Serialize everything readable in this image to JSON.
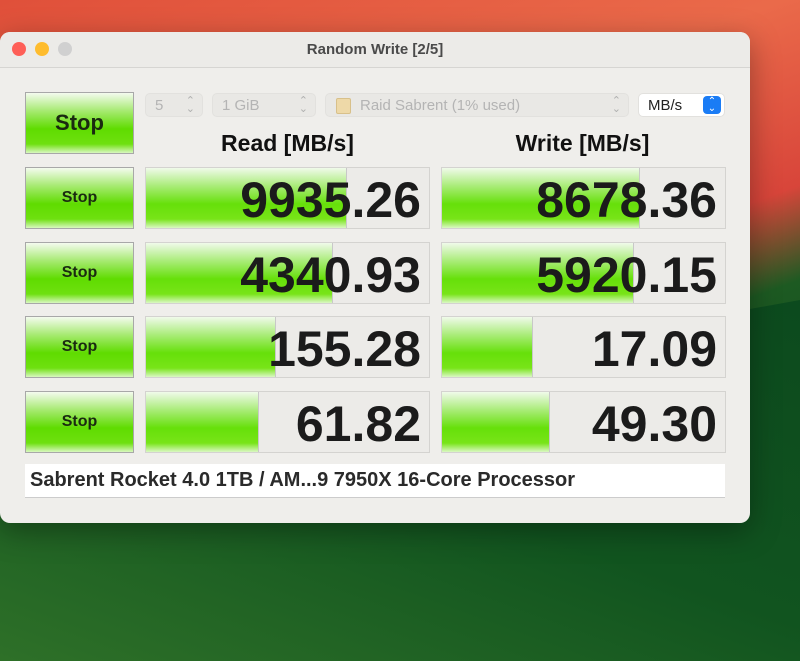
{
  "window": {
    "title": "Random Write [2/5]"
  },
  "controls": {
    "all_button": "Stop",
    "count": "5",
    "size": "1 GiB",
    "drive": "Raid Sabrent (1% used)",
    "unit": "MB/s"
  },
  "headers": {
    "read": "Read [MB/s]",
    "write": "Write [MB/s]"
  },
  "rows": [
    {
      "button": "Stop",
      "read": "9935.26",
      "read_fill": 0.71,
      "write": "8678.36",
      "write_fill": 0.7
    },
    {
      "button": "Stop",
      "read": "4340.93",
      "read_fill": 0.66,
      "write": "5920.15",
      "write_fill": 0.68
    },
    {
      "button": "Stop",
      "read": "155.28",
      "read_fill": 0.46,
      "write": "17.09",
      "write_fill": 0.32
    },
    {
      "button": "Stop",
      "read": "61.82",
      "read_fill": 0.4,
      "write": "49.30",
      "write_fill": 0.38
    }
  ],
  "description": "Sabrent Rocket 4.0 1TB / AM...9 7950X 16-Core Processor",
  "colors": {
    "accent": "#5fdc00",
    "close": "#fe5f57",
    "minimize": "#febc2e",
    "zoom": "#d0d0d0",
    "select_accent": "#1a7cf5"
  }
}
